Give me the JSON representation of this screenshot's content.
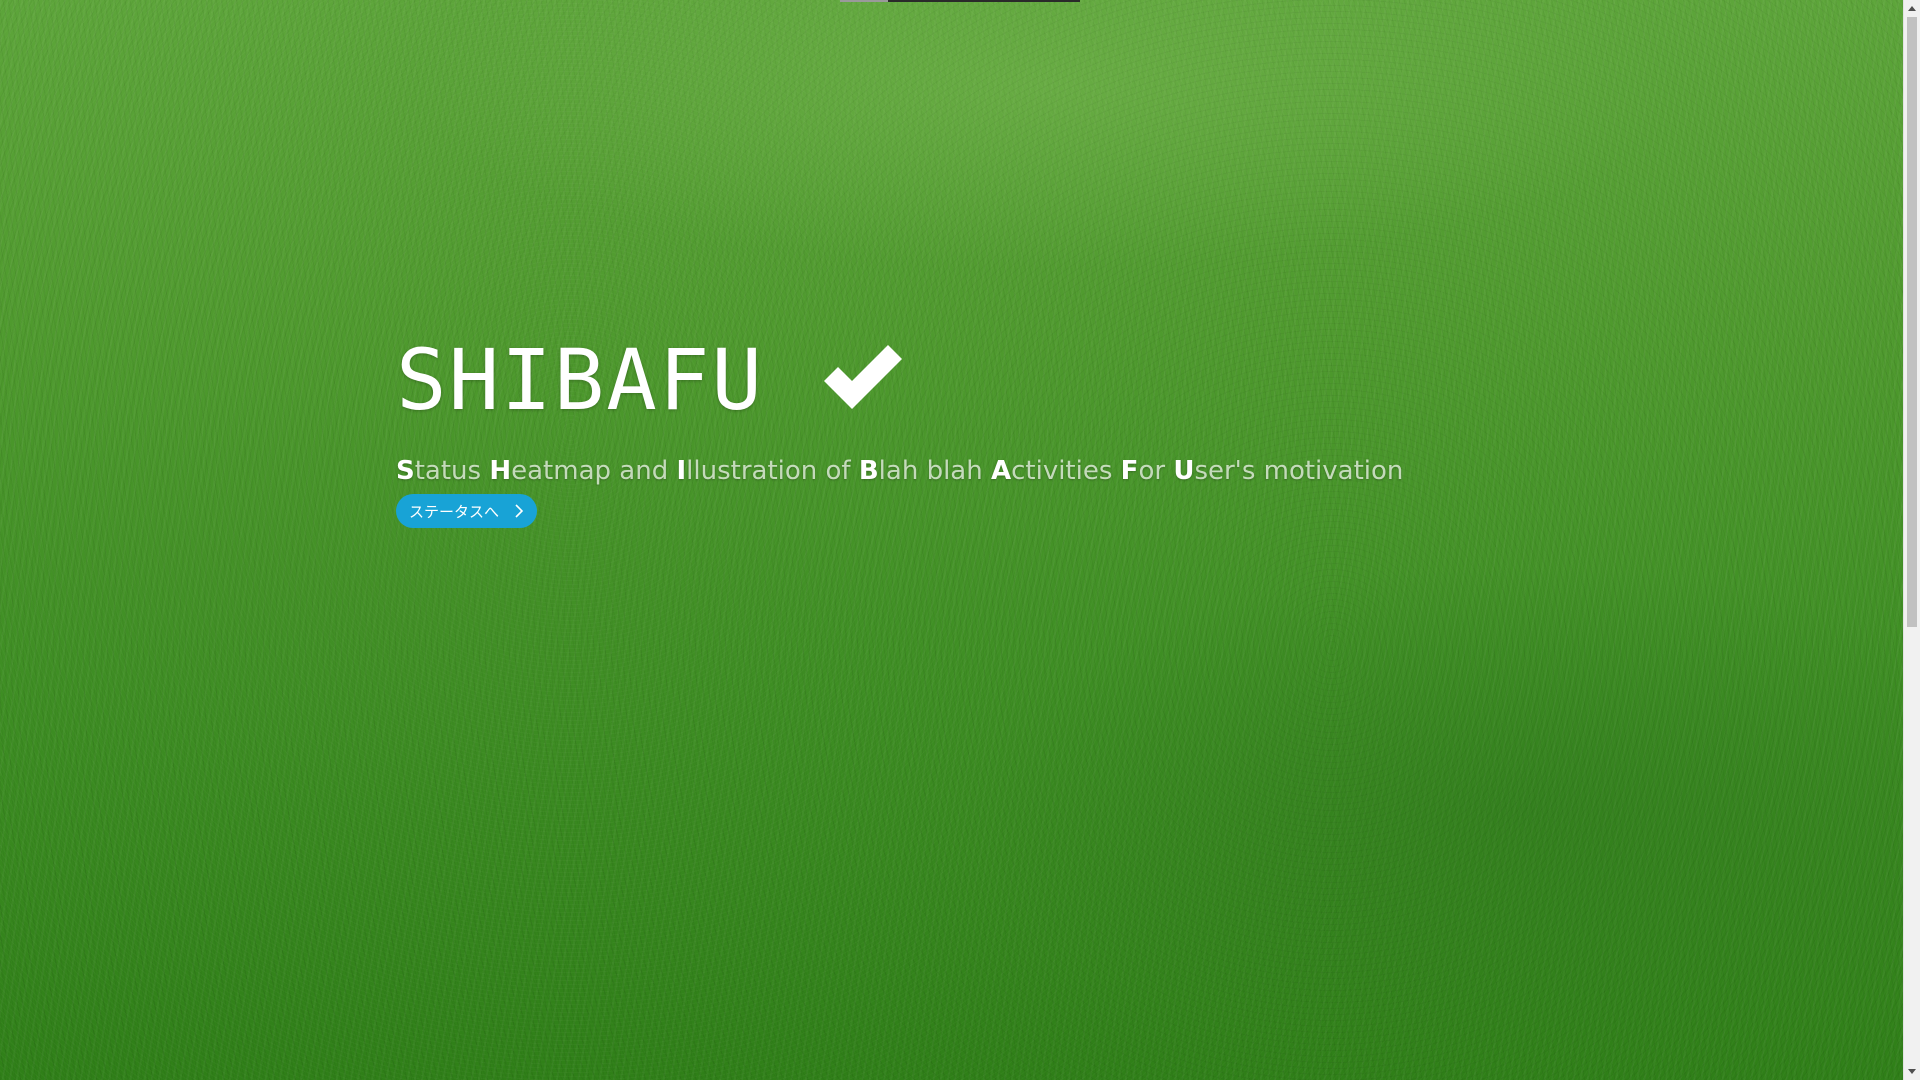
{
  "hero": {
    "title": "SHIBAFU",
    "title_icon": "check-icon",
    "tagline": [
      {
        "initial": "S",
        "rest": "tatus "
      },
      {
        "initial": "H",
        "rest": "eatmap and "
      },
      {
        "initial": "I",
        "rest": "llustration of "
      },
      {
        "initial": "B",
        "rest": "lah blah "
      },
      {
        "initial": "A",
        "rest": "ctivities "
      },
      {
        "initial": "F",
        "rest": "or "
      },
      {
        "initial": "U",
        "rest": "ser's motivation"
      }
    ],
    "button": {
      "label": "ステータスへ",
      "icon": "chevron-right-icon",
      "color": "#18a3d6"
    }
  },
  "background": {
    "description_icon": "grass-background",
    "color": "#4f9a2e"
  },
  "scrollbar": {
    "up_icon": "scroll-up-arrow-icon",
    "down_icon": "scroll-down-arrow-icon"
  }
}
